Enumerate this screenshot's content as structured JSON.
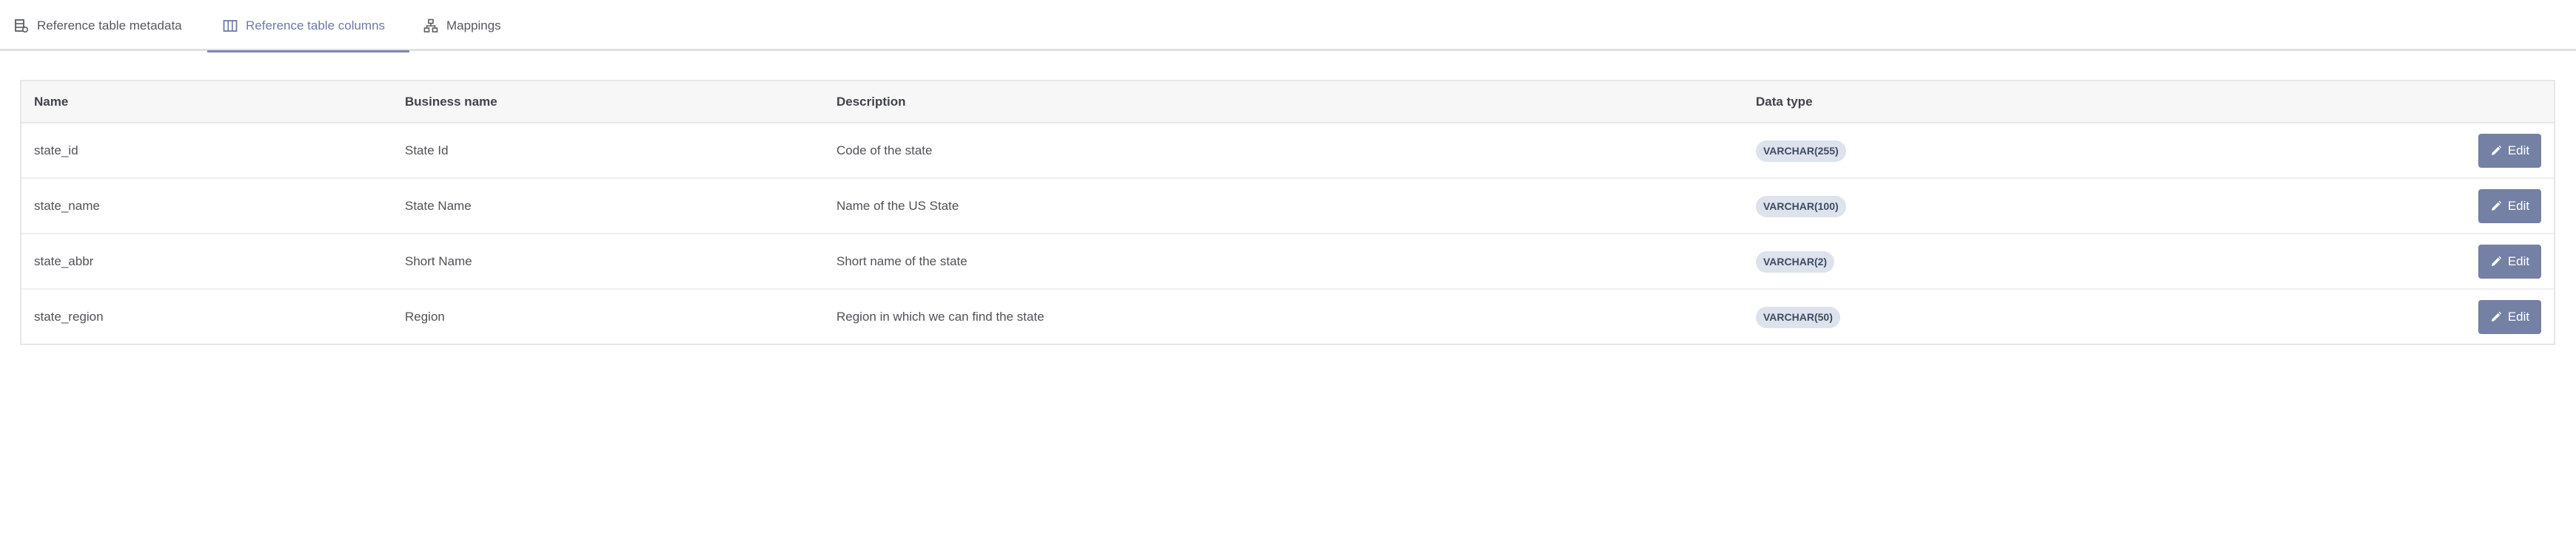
{
  "tabs": [
    {
      "label": "Reference table metadata",
      "icon": "table-metadata-icon",
      "active": false
    },
    {
      "label": "Reference table columns",
      "icon": "columns-icon",
      "active": true
    },
    {
      "label": "Mappings",
      "icon": "mappings-icon",
      "active": false
    }
  ],
  "table": {
    "headers": {
      "name": "Name",
      "business_name": "Business name",
      "description": "Description",
      "data_type": "Data type"
    },
    "rows": [
      {
        "name": "state_id",
        "business_name": "State Id",
        "description": "Code of the state",
        "data_type": "VARCHAR(255)",
        "action": "Edit"
      },
      {
        "name": "state_name",
        "business_name": "State Name",
        "description": "Name of the US State",
        "data_type": "VARCHAR(100)",
        "action": "Edit"
      },
      {
        "name": "state_abbr",
        "business_name": "Short Name",
        "description": "Short name of the state",
        "data_type": "VARCHAR(2)",
        "action": "Edit"
      },
      {
        "name": "state_region",
        "business_name": "Region",
        "description": "Region in which we can find the state",
        "data_type": "VARCHAR(50)",
        "action": "Edit"
      }
    ]
  },
  "colors": {
    "accent": "#7480a4",
    "badge_bg": "#dde3ec",
    "header_bg": "#f7f7f8"
  }
}
